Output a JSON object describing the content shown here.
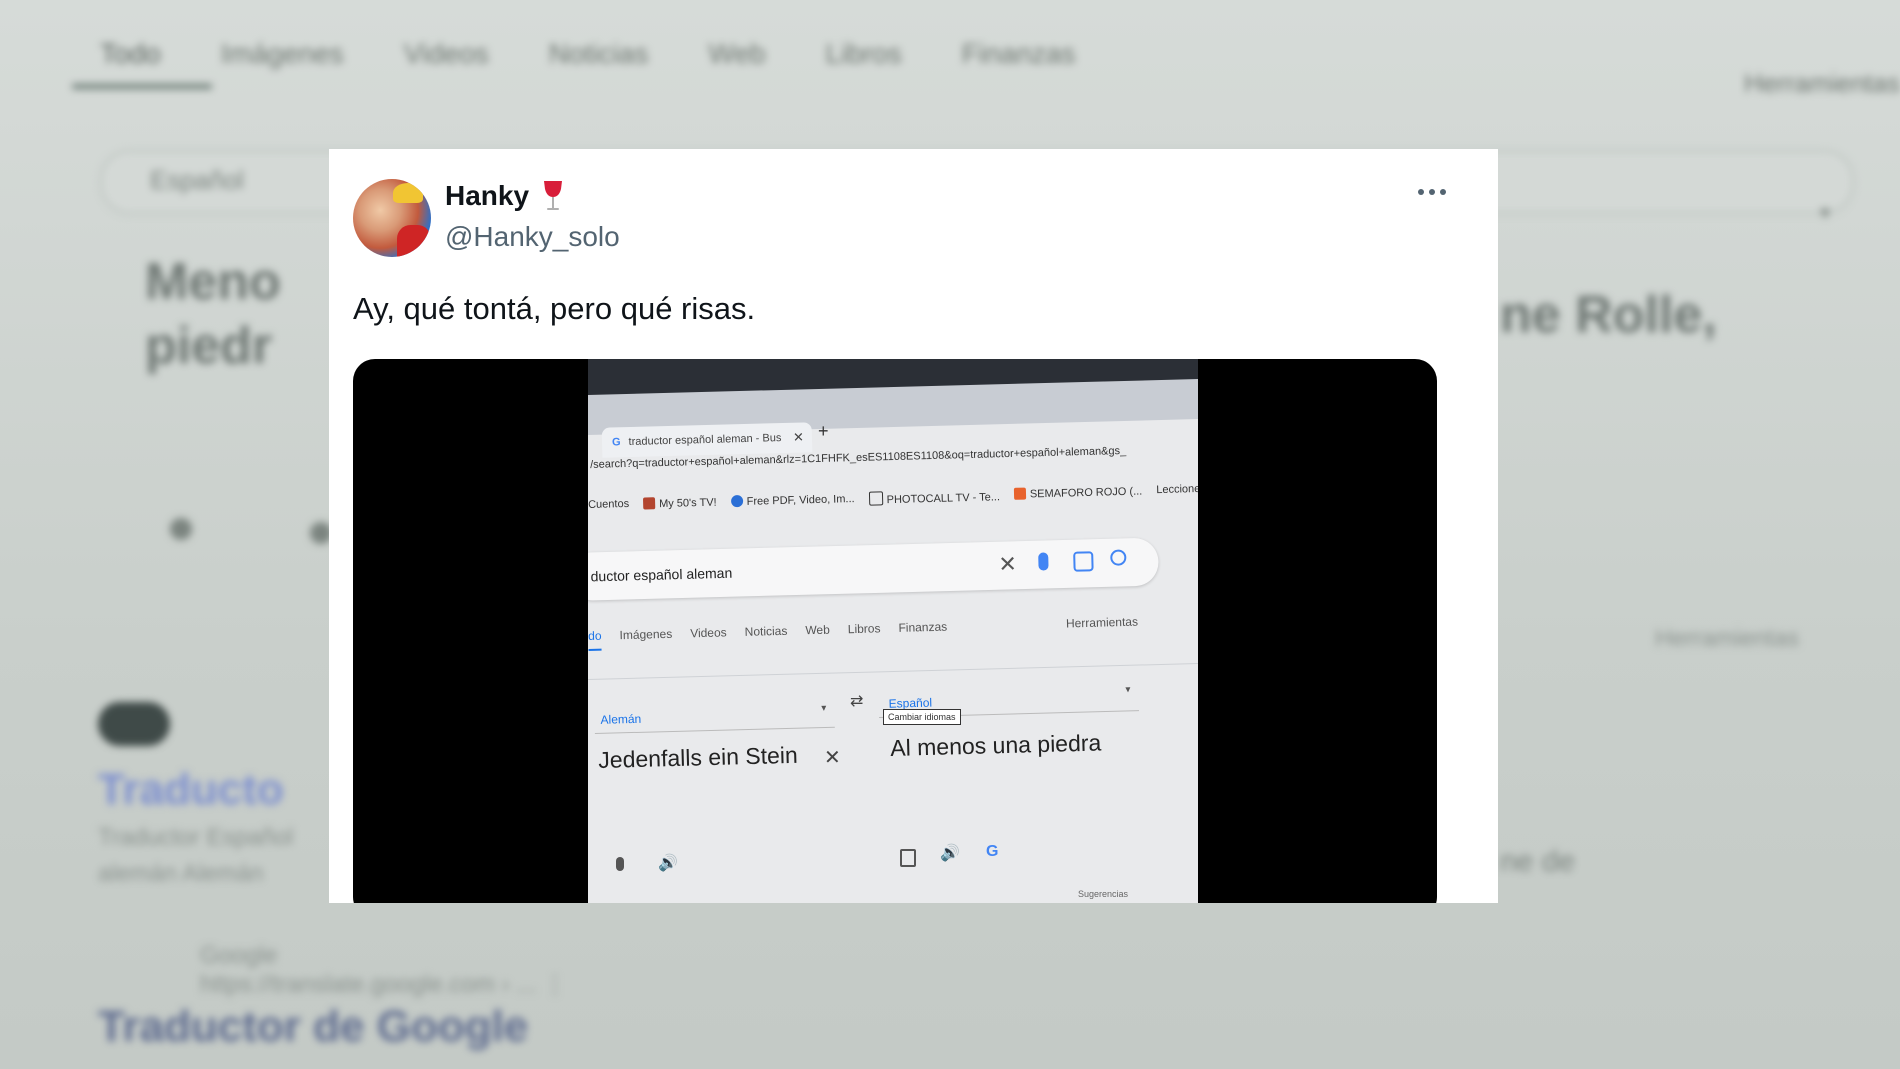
{
  "background": {
    "tabs": [
      "Todo",
      "Imágenes",
      "Videos",
      "Noticias",
      "Web",
      "Libros",
      "Finanzas"
    ],
    "tools_label": "Herramientas",
    "search_placeholder": "Español",
    "heading_left": "Meno\npiedr",
    "heading_right": "ne Rolle,",
    "right_link": "Herramientas",
    "right_snippet": "ne de",
    "result1_title": "Traducto",
    "result1_snippet": "Traductor Español\nalemán Alemán",
    "result2_site": "Google",
    "result2_url": "https://translate.google.com › ... ⋮",
    "result2_title": "Traductor de Google"
  },
  "tweet": {
    "author_name": "Hanky",
    "author_handle": "@Hanky_solo",
    "text": "Ay, qué tontá, pero qué risas.",
    "more_icon": "more-dots-icon",
    "emoji": "wine-glass-icon"
  },
  "video": {
    "tab_title": "traductor español aleman - Bus",
    "url": "/search?q=traductor+español+aleman&rlz=1C1FHFK_esES1108ES1108&oq=traductor+español+aleman&gs_",
    "bookmarks": [
      "Cuentos",
      "My 50's TV!",
      "Free PDF, Video, Im...",
      "PHOTOCALL TV - Te...",
      "SEMAFORO ROJO (...",
      "Lecciones"
    ],
    "search_query": "ductor español aleman",
    "filters": [
      "do",
      "Imágenes",
      "Videos",
      "Noticias",
      "Web",
      "Libros",
      "Finanzas"
    ],
    "tools": "Herramientas",
    "lang_from": "Alemán",
    "lang_to": "Español",
    "tooltip": "Cambiar idiomas",
    "source_text": "Jedenfalls ein Stein",
    "translated_text": "Al menos una piedra",
    "suggest": "Sugerencias"
  }
}
